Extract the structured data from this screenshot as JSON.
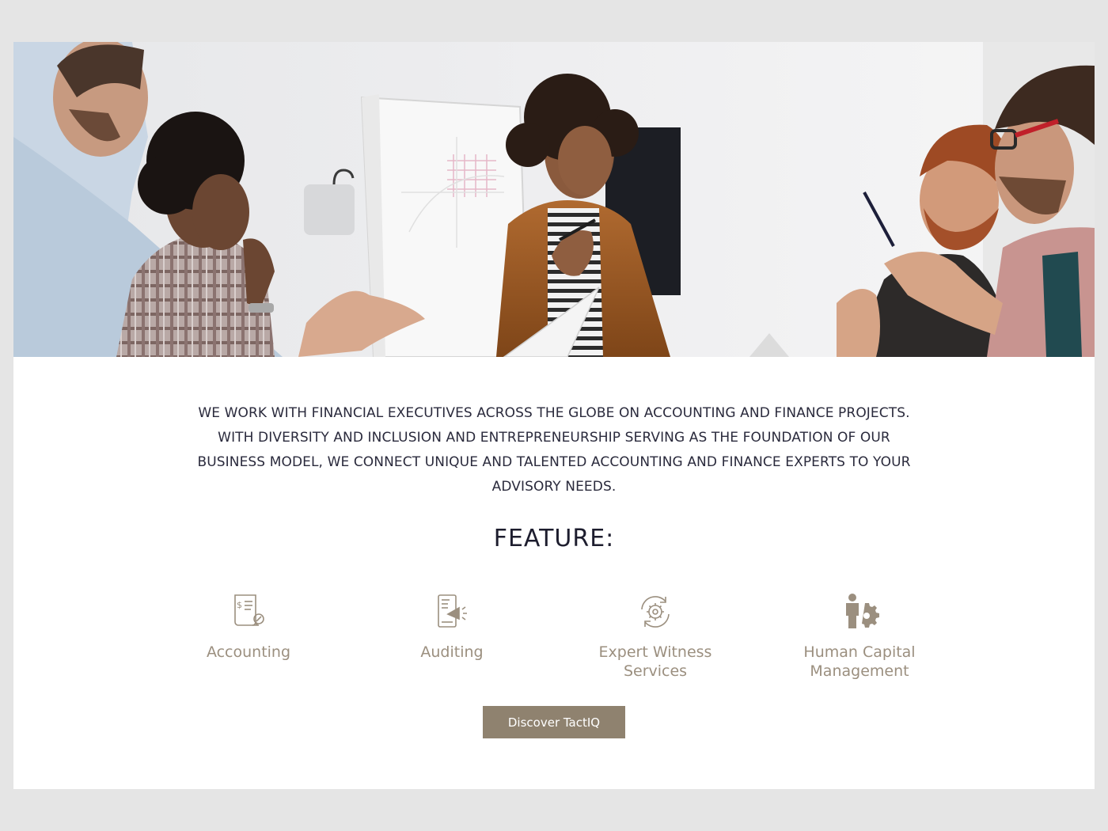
{
  "intro": {
    "lines": [
      "WE WORK WITH FINANCIAL EXECUTIVES ACROSS THE GLOBE ON ACCOUNTING AND FINANCE PROJECTS.",
      "WITH DIVERSITY AND INCLUSION AND ENTREPRENEURSHIP SERVING AS THE FOUNDATION OF OUR",
      "BUSINESS MODEL, WE CONNECT UNIQUE AND TALENTED ACCOUNTING AND FINANCE EXPERTS TO YOUR",
      "ADVISORY NEEDS."
    ]
  },
  "feature_title": "FEATURE:",
  "features": [
    {
      "label": "Accounting",
      "icon": "accounting-document-icon"
    },
    {
      "label": "Auditing",
      "icon": "auditing-megaphone-icon"
    },
    {
      "label_line1": "Expert Witness",
      "label_line2": "Services",
      "icon": "gear-cycle-icon"
    },
    {
      "label_line1": "Human Capital",
      "label_line2": "Management",
      "icon": "person-gear-icon"
    }
  ],
  "cta": {
    "label": "Discover TactIQ"
  },
  "colors": {
    "accent": "#8f826f",
    "feature_text": "#9b8f7f",
    "body_text": "#2a2a3c",
    "page_bg": "#e5e5e5"
  }
}
